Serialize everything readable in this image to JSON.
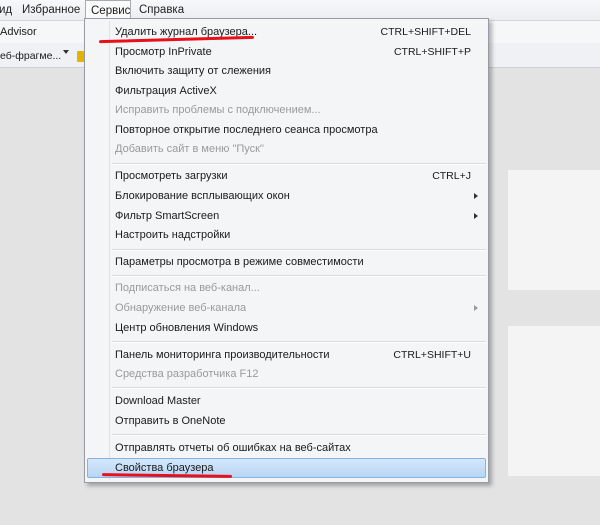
{
  "menubar": {
    "items": [
      {
        "label": "ид"
      },
      {
        "label": "Избранное"
      },
      {
        "label": "Сервис"
      },
      {
        "label": "Справка"
      }
    ]
  },
  "toolbar": {
    "favorite_label": "Advisor",
    "webslice_label": "еб-фрагме..."
  },
  "menu": {
    "items": [
      {
        "label": "Удалить журнал браузера...",
        "shortcut": "CTRL+SHIFT+DEL"
      },
      {
        "label": "Просмотр InPrivate",
        "shortcut": "CTRL+SHIFT+P"
      },
      {
        "label": "Включить защиту от слежения"
      },
      {
        "label": "Фильтрация ActiveX"
      },
      {
        "label": "Исправить проблемы с подключением...",
        "disabled": true
      },
      {
        "label": "Повторное открытие последнего сеанса просмотра"
      },
      {
        "label": "Добавить сайт в меню \"Пуск\"",
        "disabled": true
      },
      {
        "label": "Просмотреть загрузки",
        "shortcut": "CTRL+J"
      },
      {
        "label": "Блокирование всплывающих окон",
        "submenu": true
      },
      {
        "label": "Фильтр SmartScreen",
        "submenu": true
      },
      {
        "label": "Настроить надстройки"
      },
      {
        "label": "Параметры просмотра в режиме совместимости"
      },
      {
        "label": "Подписаться на веб-канал...",
        "disabled": true
      },
      {
        "label": "Обнаружение веб-канала",
        "disabled": true,
        "submenu": true
      },
      {
        "label": "Центр обновления Windows"
      },
      {
        "label": "Панель мониторинга производительности",
        "shortcut": "CTRL+SHIFT+U"
      },
      {
        "label": "Средства разработчика F12",
        "disabled": true
      },
      {
        "label": "Download Master"
      },
      {
        "label": "Отправить в OneNote"
      },
      {
        "label": "Отправлять отчеты об ошибках на веб-сайтах"
      },
      {
        "label": "Свойства браузера",
        "selected": true
      }
    ]
  },
  "colors": {
    "highlight": "#b9d6f5",
    "annotation_red": "#e8101a"
  }
}
